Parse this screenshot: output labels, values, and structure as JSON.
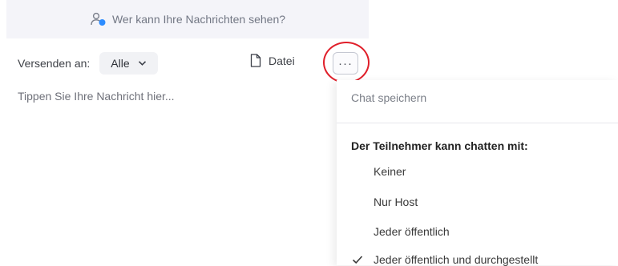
{
  "info_bar": {
    "text": "Wer kann Ihre Nachrichten sehen?",
    "icon": "people-visibility-icon"
  },
  "composer": {
    "send_to_label": "Versenden an:",
    "recipient_value": "Alle",
    "file_label": "Datei",
    "more_label": "···",
    "message_placeholder": "Tippen Sie Ihre Nachricht hier..."
  },
  "menu": {
    "save_chat": "Chat speichern",
    "heading": "Der Teilnehmer kann chatten mit:",
    "options": [
      {
        "label": "Keiner",
        "checked": false
      },
      {
        "label": "Nur Host",
        "checked": false
      },
      {
        "label": "Jeder öffentlich",
        "checked": false
      },
      {
        "label": "Jeder öffentlich und durchgestellt",
        "checked": true
      }
    ]
  },
  "colors": {
    "highlight_ring": "#e01f2a",
    "info_bar_bg": "#f4f4f9",
    "people_icon_accent": "#2d8cff"
  }
}
